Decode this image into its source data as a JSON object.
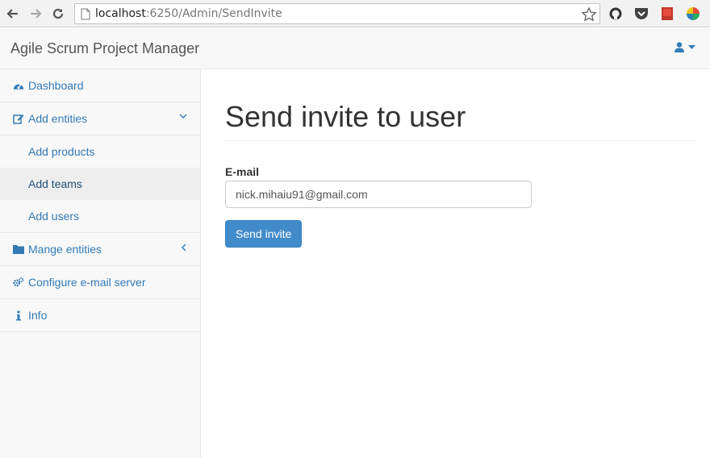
{
  "browser": {
    "url_host": "localhost",
    "url_rest": ":6250/Admin/SendInvite"
  },
  "navbar": {
    "brand": "Agile Scrum Project Manager"
  },
  "sidebar": {
    "items": [
      {
        "label": "Dashboard",
        "icon": "dashboard-icon"
      },
      {
        "label": "Add entities",
        "icon": "edit-icon",
        "expanded": true,
        "children": [
          "Add products",
          "Add teams",
          "Add users"
        ],
        "active_child": "Add teams"
      },
      {
        "label": "Mange entities",
        "icon": "folder-icon",
        "expanded": false
      },
      {
        "label": "Configure e-mail server",
        "icon": "gears-icon"
      },
      {
        "label": "Info",
        "icon": "info-icon"
      }
    ]
  },
  "main": {
    "title": "Send invite to user",
    "email_label": "E-mail",
    "email_value": "nick.mihaiu91@gmail.com",
    "send_label": "Send invite"
  },
  "colors": {
    "link": "#337ab7",
    "button": "#428bca"
  }
}
